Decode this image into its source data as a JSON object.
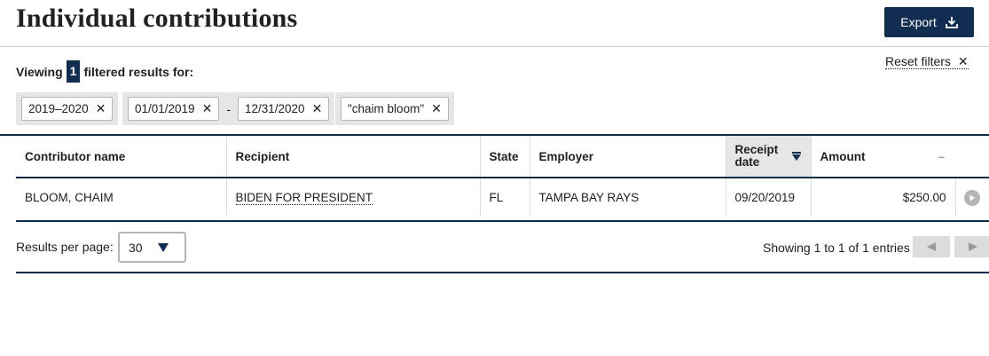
{
  "header": {
    "title": "Individual contributions",
    "export_label": "Export"
  },
  "filters": {
    "viewing_prefix": "Viewing",
    "count": "1",
    "viewing_suffix": "filtered results for:",
    "reset_label": "Reset filters",
    "cycle": "2019–2020",
    "date_from": "01/01/2019",
    "date_separator": "-",
    "date_to": "12/31/2020",
    "name": "\"chaim bloom\"",
    "remove_glyph": "✕"
  },
  "table": {
    "columns": [
      "Contributor name",
      "Recipient",
      "State",
      "Employer",
      "Receipt date",
      "Amount"
    ],
    "rows": [
      {
        "contributor": "BLOOM, CHAIM",
        "recipient": "BIDEN FOR PRESIDENT",
        "state": "FL",
        "employer": "TAMPA BAY RAYS",
        "receipt_date": "09/20/2019",
        "amount": "$250.00"
      }
    ],
    "collapse_glyph": "–"
  },
  "pagination": {
    "per_page_label": "Results per page:",
    "per_page_value": "30",
    "showing_text": "Showing 1 to 1 of 1 entries"
  },
  "colors": {
    "primary": "#112e51",
    "chip_bg": "#e6e6e6",
    "disabled": "#dcdcdc"
  }
}
